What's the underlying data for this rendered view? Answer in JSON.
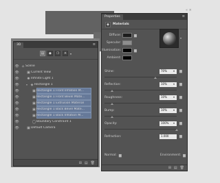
{
  "panel3d": {
    "tab_label": "3D",
    "window_controls": "« ×",
    "menu_icon": "≡",
    "filter_buttons": [
      "▤",
      "◆",
      "❍",
      "☀"
    ],
    "filter_dropdown": "▾",
    "tree": [
      {
        "label": "Scene",
        "icon": "⌂",
        "indent": 0,
        "selected": false
      },
      {
        "label": "Current View",
        "icon": "▣",
        "indent": 1,
        "selected": false
      },
      {
        "label": "Infinite Light 1",
        "icon": "✺",
        "indent": 1,
        "selected": false
      },
      {
        "label": "Rectangle 1",
        "icon": "◈",
        "indent": 1,
        "selected": false,
        "expanded": true
      },
      {
        "label": "Rectangle 1 Front Inflation M...",
        "icon": "▣",
        "indent": 2,
        "selected": true
      },
      {
        "label": "Rectangle 1 Front Bevel Mate...",
        "icon": "▣",
        "indent": 2,
        "selected": true
      },
      {
        "label": "Rectangle 1 Extrusion Material",
        "icon": "▣",
        "indent": 2,
        "selected": true
      },
      {
        "label": "Rectangle 1 Back Bevel Mate...",
        "icon": "▣",
        "indent": 2,
        "selected": true
      },
      {
        "label": "Rectangle 1 Back Inflation M...",
        "icon": "▣",
        "indent": 2,
        "selected": true
      },
      {
        "label": "Boundary Constraint 1",
        "icon": "◯",
        "indent": 2,
        "selected": false
      },
      {
        "label": "Default Camera",
        "icon": "▣",
        "indent": 1,
        "selected": false
      }
    ],
    "bottom_icons": [
      "⊞",
      "▤",
      "🗑"
    ]
  },
  "properties": {
    "tab_label": "Properties",
    "window_controls": "« ×",
    "menu_icon": "≡",
    "section_title": "Materials",
    "swatches": [
      {
        "label": "Diffuse:",
        "color": "#1d1d1d"
      },
      {
        "label": "Specular:",
        "color": "#8e8e8e"
      },
      {
        "label": "Illumination:",
        "color": "#050505"
      },
      {
        "label": "Ambient:",
        "color": "#050505"
      }
    ],
    "props": [
      {
        "name": "Shine:",
        "value": "70%",
        "fraction": 0.7
      },
      {
        "name": "Reflection:",
        "value": "10%",
        "fraction": 0.1
      },
      {
        "name": "Roughness:",
        "value": "10%",
        "fraction": 0.1
      },
      {
        "name": "Bump:",
        "value": "10%",
        "fraction": 0.1
      },
      {
        "name": "Opacity:",
        "value": "100%",
        "fraction": 1.0
      },
      {
        "name": "Refraction:",
        "value": "1.000",
        "fraction": null
      }
    ],
    "normal_label": "Normal:",
    "environment_label": "Environment:",
    "bottom_icons": [
      "⊞",
      "▤",
      "🗑"
    ]
  }
}
